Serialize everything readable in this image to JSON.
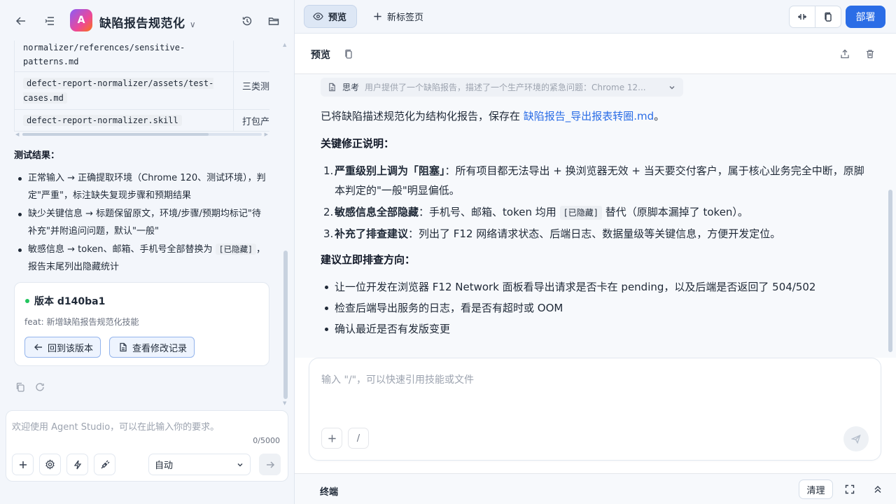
{
  "app": {
    "badge_letter": "A",
    "title": "缺陷报告规范化"
  },
  "file_table": {
    "rows": [
      {
        "path": "normalizer/references/sensitive-patterns.md",
        "desc": ""
      },
      {
        "path": "defect-report-normalizer/assets/test-cases.md",
        "desc": "三类测"
      },
      {
        "path": "defect-report-normalizer.skill",
        "desc": "打包产"
      }
    ]
  },
  "test_results": {
    "heading": "测试结果：",
    "items": [
      {
        "text": "正常输入 → 正确提取环境（Chrome 120、测试环境），判定\"严重\"，标注缺失复现步骤和预期结果"
      },
      {
        "text": "缺少关键信息 → 标题保留原文，环境/步骤/预期均标记\"待补充\"并附追问问题，默认\"一般\""
      },
      {
        "text_before": "敏感信息 → token、邮箱、手机号全部替换为 ",
        "code": "[已隐藏]",
        "text_after": "，报告末尾列出隐藏统计"
      }
    ]
  },
  "version_card": {
    "title": "版本 d140ba1",
    "subtitle": "feat: 新增缺陷报告规范化技能",
    "revert_label": "回到该版本",
    "changes_label": "查看修改记录"
  },
  "left_composer": {
    "placeholder": "欢迎使用 Agent Studio，可以在此输入你的要求。",
    "counter": "0/5000",
    "mode": "自动"
  },
  "tabs": [
    {
      "label": "预览",
      "active": true
    },
    {
      "label": "新标签页",
      "active": false
    }
  ],
  "deploy_label": "部署",
  "preview": {
    "title": "预览",
    "thinking": {
      "label": "思考",
      "text": "用户提供了一个缺陷报告，描述了一个生产环境的紧急问题：Chrome 12..."
    },
    "intro_before": "已将缺陷描述规范化为结构化报告，保存在 ",
    "intro_link": "缺陷报告_导出报表转圈.md",
    "intro_after": "。",
    "fix_heading": "关键修正说明：",
    "fixes": [
      {
        "num": "1.",
        "bold": "严重级别上调为「阻塞」",
        "text": "：所有项目都无法导出 + 换浏览器无效 + 当天要交付客户，属于核心业务完全中断，原脚本判定的\"一般\"明显偏低。"
      },
      {
        "num": "2.",
        "bold": "敏感信息全部隐藏",
        "text": "：手机号、邮箱、token 均用 ",
        "code": "[已隐藏]",
        "text_after": " 替代（原脚本漏掉了 token）。"
      },
      {
        "num": "3.",
        "bold": "补充了排查建议",
        "text": "：列出了 F12 网络请求状态、后端日志、数据量级等关键信息，方便开发定位。"
      }
    ],
    "debug_heading": "建议立即排查方向：",
    "debug_items": [
      "让一位开发在浏览器 F12 Network 面板看导出请求是否卡在 pending，以及后端是否返回了 504/502",
      "检查后端导出服务的日志，看是否有超时或 OOM",
      "确认最近是否有发版变更"
    ]
  },
  "chat": {
    "placeholder": "输入 \"/\"，可以快速引用技能或文件",
    "slash": "/"
  },
  "terminal": {
    "label": "终端",
    "clear_label": "清理"
  },
  "colors": {
    "accent": "#2b6de6",
    "success": "#22c55e"
  }
}
